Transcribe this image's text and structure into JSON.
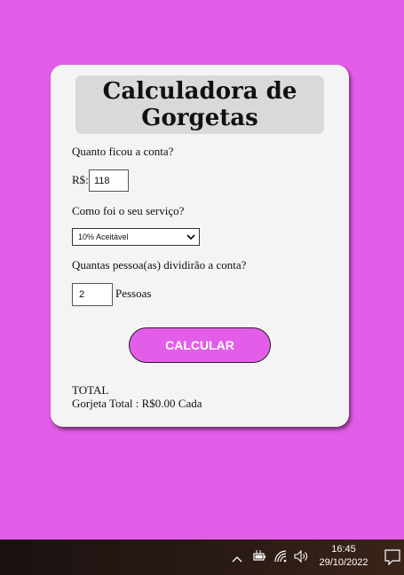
{
  "app": {
    "title": "Calculadora de Gorgetas"
  },
  "form": {
    "bill_question": "Quanto ficou a conta?",
    "currency_label": "R$:",
    "bill_value": "118",
    "service_question": "Como foi o seu serviço?",
    "service_selected": "10% Aceitável",
    "people_question": "Quantas pessoa(as) dividirão a conta?",
    "people_value": "2",
    "people_unit": "Pessoas",
    "calculate_label": "CALCULAR"
  },
  "result": {
    "total_label": "TOTAL",
    "tip_text": "Gorjeta Total : R$0.00 Cada"
  },
  "taskbar": {
    "time": "16:45",
    "date": "29/10/2022",
    "icons": [
      "chevron-up-icon",
      "battery-icon",
      "wifi-icon",
      "volume-icon",
      "notification-icon"
    ]
  },
  "colors": {
    "background": "#e35ee8",
    "card": "#f4f4f4",
    "title_box": "#d9d9d9",
    "button": "#e35ee8"
  }
}
